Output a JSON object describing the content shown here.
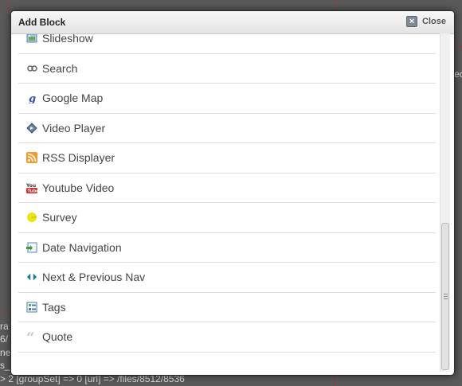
{
  "dialog": {
    "title": "Add Block",
    "close_label": "Close"
  },
  "blocks": [
    {
      "label": "Slideshow",
      "icon": "slideshow-icon"
    },
    {
      "label": "Search",
      "icon": "search-icon"
    },
    {
      "label": "Google Map",
      "icon": "google-map-icon"
    },
    {
      "label": "Video Player",
      "icon": "video-player-icon"
    },
    {
      "label": "RSS Displayer",
      "icon": "rss-icon"
    },
    {
      "label": "Youtube Video",
      "icon": "youtube-icon"
    },
    {
      "label": "Survey",
      "icon": "survey-icon"
    },
    {
      "label": "Date Navigation",
      "icon": "date-navigation-icon"
    },
    {
      "label": "Next & Previous Nav",
      "icon": "next-previous-icon"
    },
    {
      "label": "Tags",
      "icon": "tags-icon"
    },
    {
      "label": "Quote",
      "icon": "quote-icon"
    }
  ],
  "background": {
    "line1": "ra",
    "line2": "6/",
    "line3": "ne",
    "line4": "s_",
    "line5": "> 2 [groupSet] => 0 [url] => /files/8512/8536",
    "right_text": "ec"
  }
}
